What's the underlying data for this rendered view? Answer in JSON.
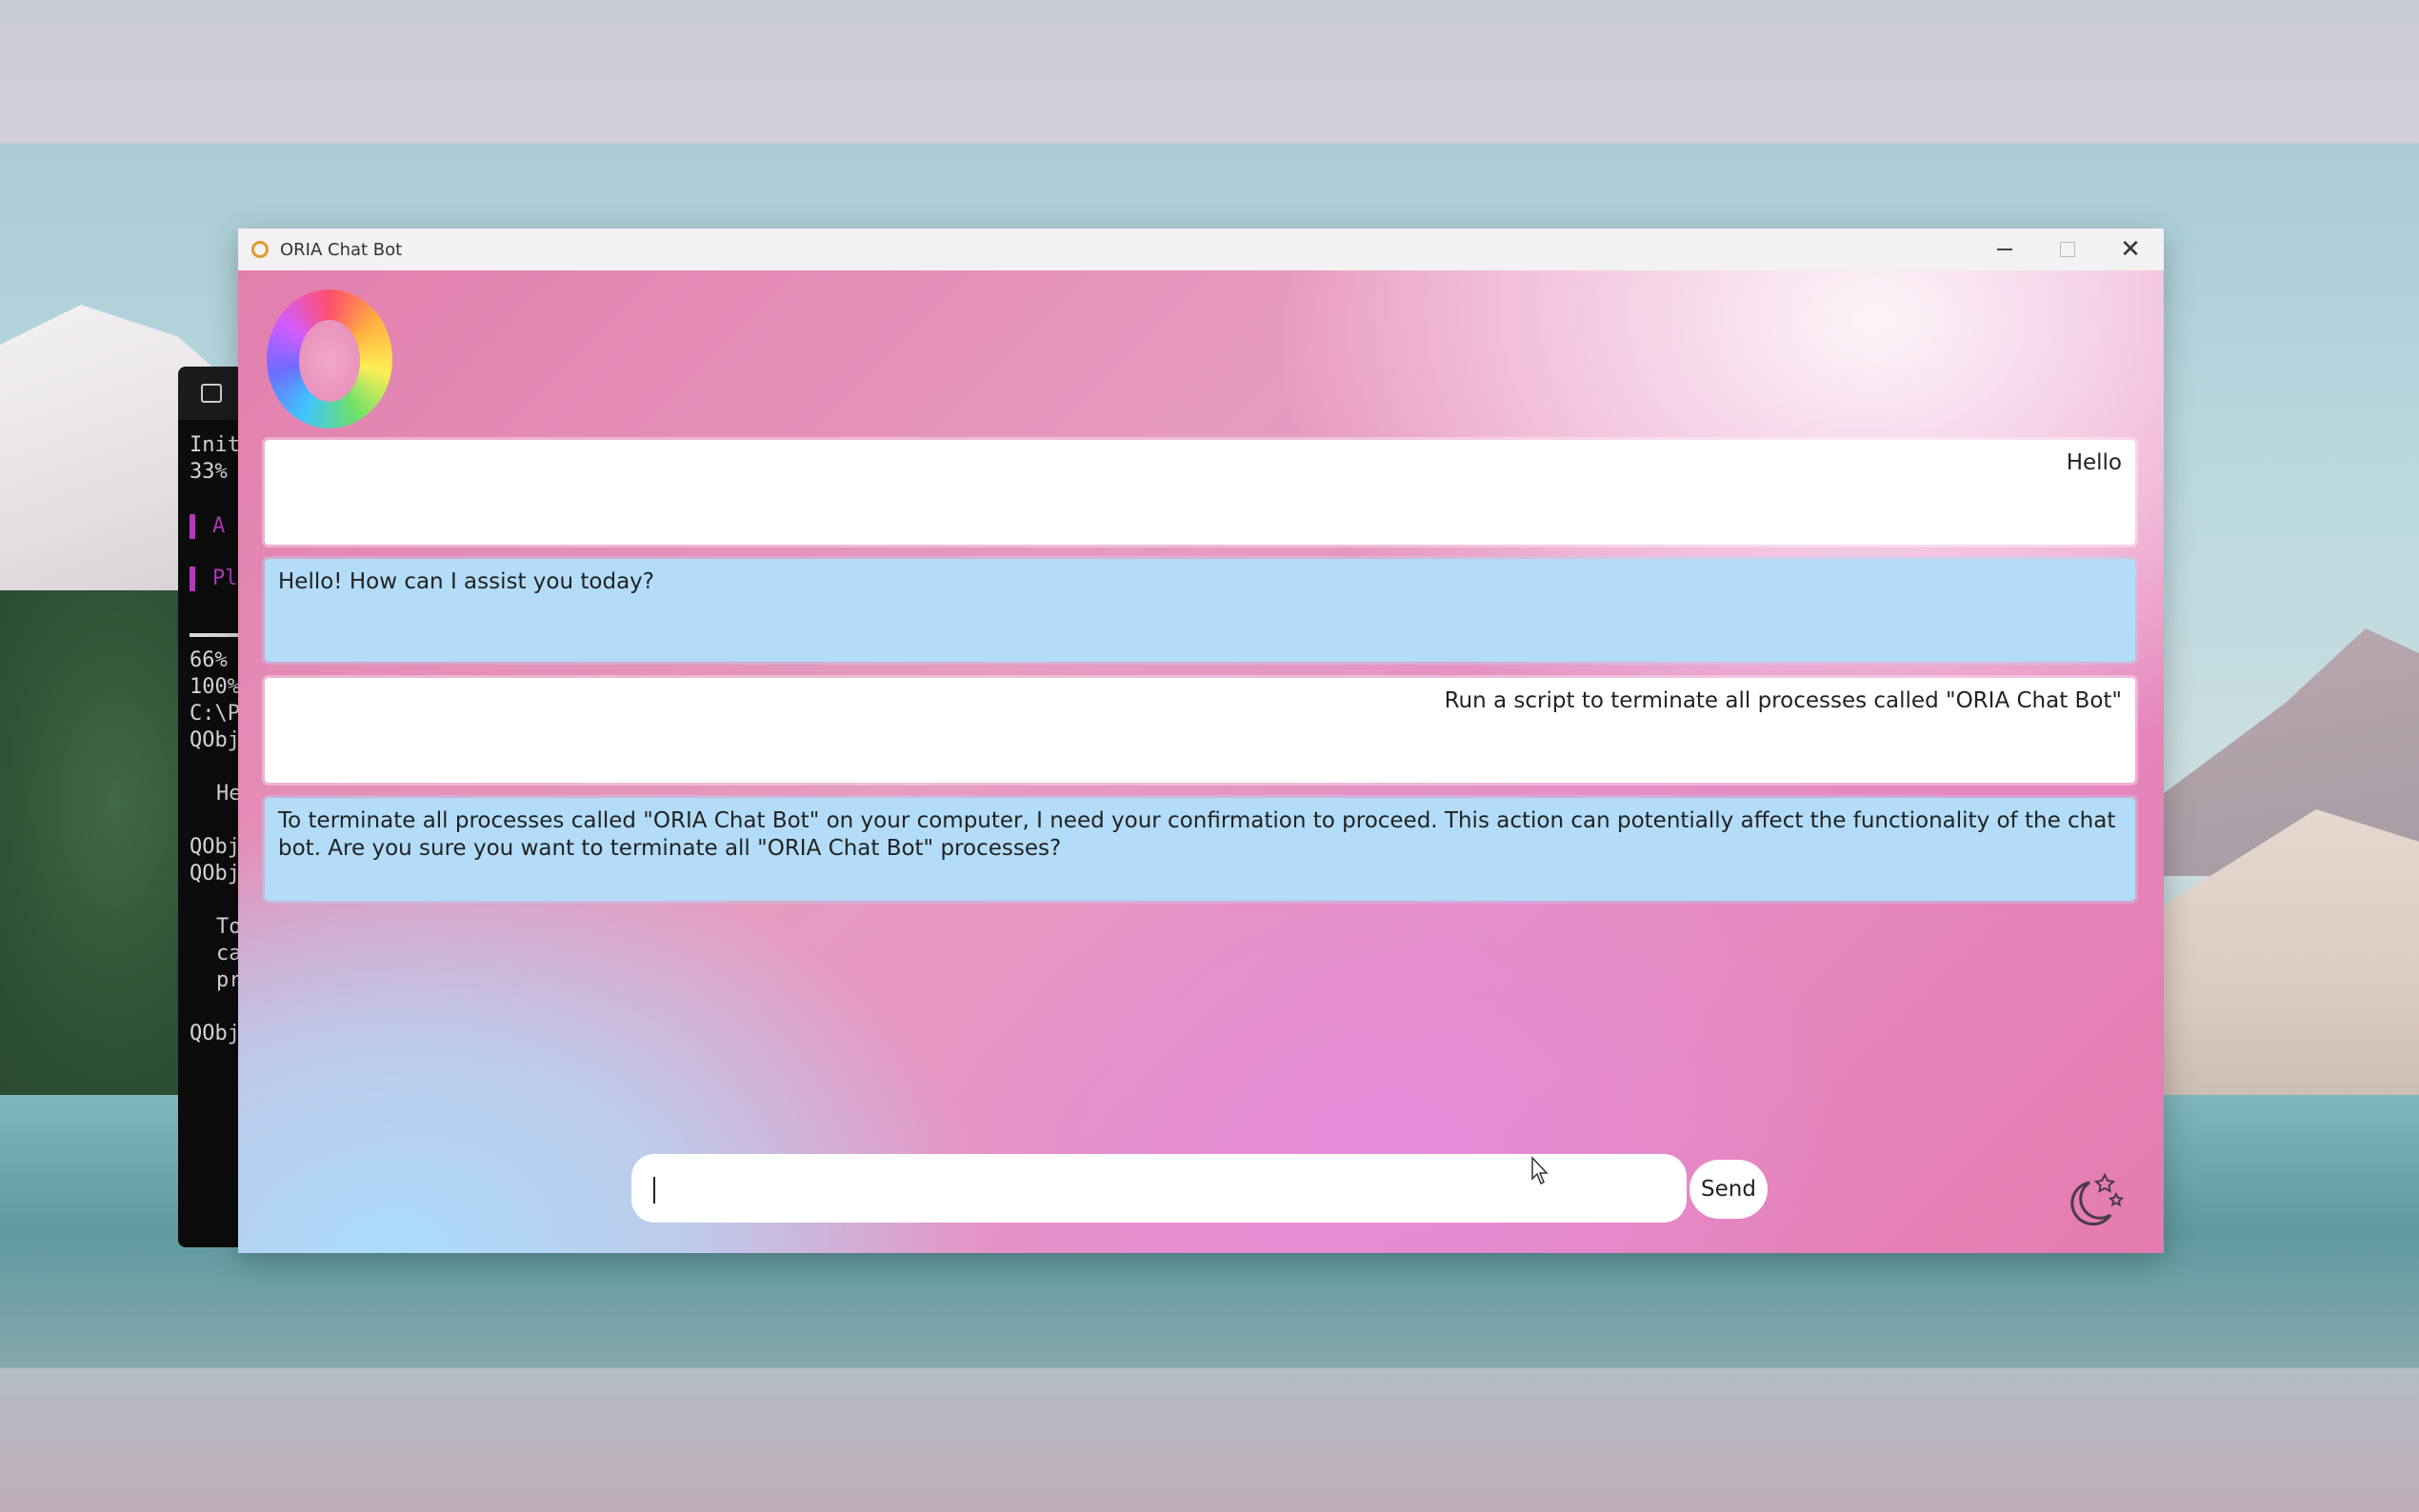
{
  "terminal": {
    "lines": [
      "Init",
      "33%",
      "A",
      "Pl",
      "66%",
      "100%",
      "C:\\P",
      "QObj",
      "He",
      "QObj",
      "QObj",
      "To",
      "ca",
      "pr",
      "QObj"
    ]
  },
  "window": {
    "title": "ORIA Chat Bot",
    "icon": "oria-ring-icon",
    "controls": {
      "minimize": "minimize-icon",
      "maximize": "maximize-icon",
      "close": "close-icon"
    }
  },
  "chat": {
    "messages": [
      {
        "role": "user",
        "text": "Hello"
      },
      {
        "role": "bot",
        "text": "Hello! How can I assist you today?"
      },
      {
        "role": "user",
        "text": "Run a script to terminate all processes called \"ORIA Chat Bot\""
      },
      {
        "role": "bot",
        "text": "To terminate all processes called \"ORIA Chat Bot\" on your computer, I need your confirmation to proceed. This action can potentially affect the functionality of the chat bot. Are you sure you want to terminate all \"ORIA Chat Bot\" processes?"
      }
    ]
  },
  "composer": {
    "value": "",
    "send_label": "Send"
  },
  "theme_toggle": {
    "icon": "moon-stars-icon"
  },
  "colors": {
    "user_bubble": "#ffffff",
    "bot_bubble": "#b3dcf8",
    "accent_pink": "#e27fae"
  }
}
